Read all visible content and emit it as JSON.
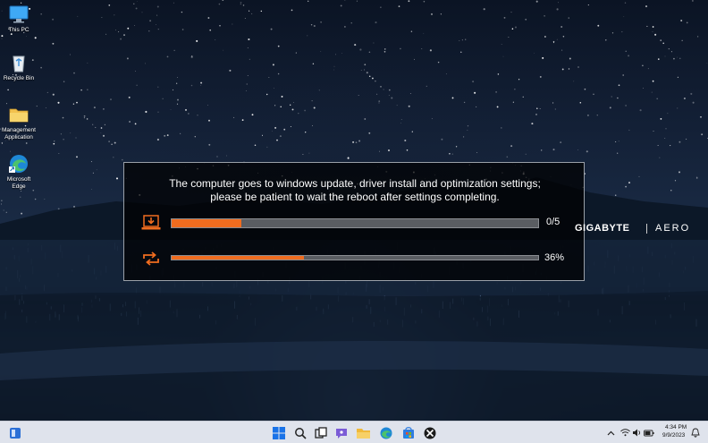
{
  "desktop": {
    "icons": [
      {
        "label": "This PC"
      },
      {
        "label": "Recycle Bin"
      },
      {
        "label": "Management Application"
      },
      {
        "label": "Microsoft Edge"
      }
    ]
  },
  "dialog": {
    "message_line1": "The computer goes to windows update, driver install and optimization settings;",
    "message_line2": "please be patient to wait the reboot after settings completing.",
    "update_progress": {
      "label": "0/5",
      "fraction": 0.19
    },
    "optimize_progress": {
      "label": "36%",
      "fraction": 0.36
    }
  },
  "brand": {
    "primary": "GIGABYTE",
    "secondary": "AERO"
  },
  "taskbar": {
    "apps": [
      "start",
      "search",
      "task-view",
      "widgets",
      "chat",
      "file-explorer",
      "edge",
      "store",
      "xbox"
    ],
    "clock_time": "4:34 PM",
    "clock_date": "9/9/2023"
  },
  "colors": {
    "accent": "#ef6c1f",
    "taskbar": "#dfe3ec"
  }
}
